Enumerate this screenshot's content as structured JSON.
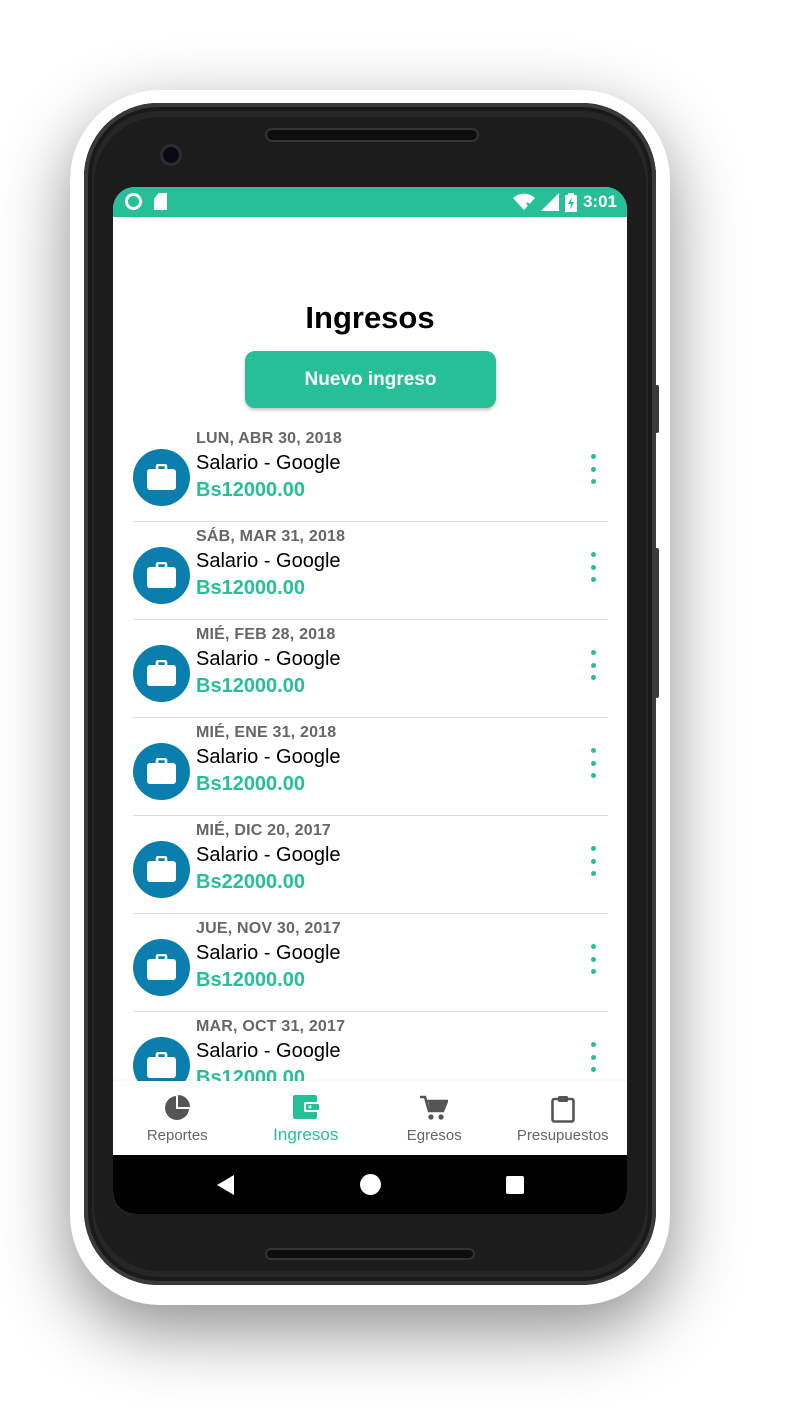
{
  "status_bar": {
    "time": "3:01"
  },
  "page": {
    "title": "Ingresos",
    "new_button_label": "Nuevo ingreso"
  },
  "entries": [
    {
      "date": "LUN, ABR 30, 2018",
      "title": "Salario - Google",
      "amount": "Bs12000.00"
    },
    {
      "date": "SÁB, MAR 31, 2018",
      "title": "Salario - Google",
      "amount": "Bs12000.00"
    },
    {
      "date": "MIÉ, FEB 28, 2018",
      "title": "Salario - Google",
      "amount": "Bs12000.00"
    },
    {
      "date": "MIÉ, ENE 31, 2018",
      "title": "Salario - Google",
      "amount": "Bs12000.00"
    },
    {
      "date": "MIÉ, DIC 20, 2017",
      "title": "Salario - Google",
      "amount": "Bs22000.00"
    },
    {
      "date": "JUE, NOV 30, 2017",
      "title": "Salario - Google",
      "amount": "Bs12000.00"
    },
    {
      "date": "MAR, OCT 31, 2017",
      "title": "Salario - Google",
      "amount": "Bs12000.00"
    }
  ],
  "entry_icon": "briefcase-icon",
  "bottom_nav": {
    "items": [
      {
        "label": "Reportes",
        "icon": "pie-chart-icon",
        "active": false
      },
      {
        "label": "Ingresos",
        "icon": "wallet-icon",
        "active": true
      },
      {
        "label": "Egresos",
        "icon": "cart-icon",
        "active": false
      },
      {
        "label": "Presupuestos",
        "icon": "clipboard-icon",
        "active": false
      }
    ]
  },
  "colors": {
    "accent": "#26bf97",
    "avatar": "#0a7ead",
    "date_text": "#666666"
  }
}
